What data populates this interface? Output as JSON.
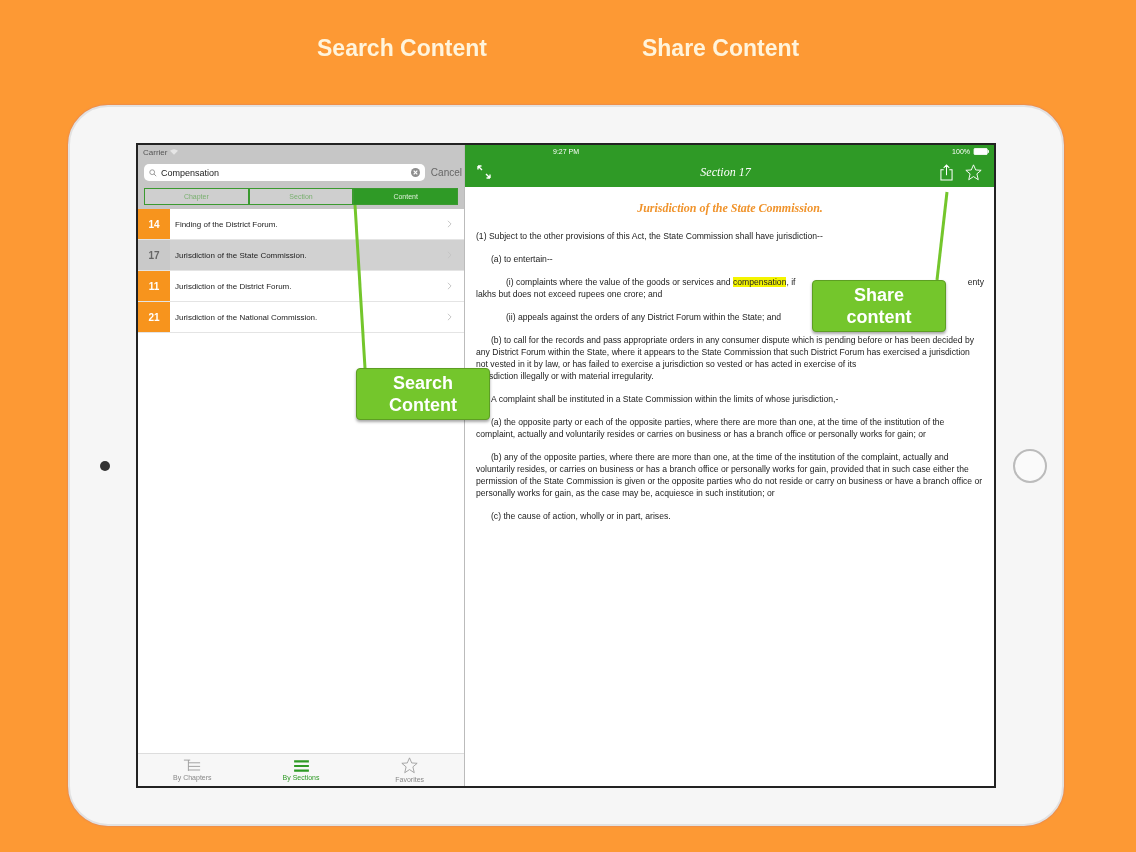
{
  "headlines": [
    {
      "text": "Search Content"
    },
    {
      "text": "Share Content"
    }
  ],
  "left_pane": {
    "status_bar": {
      "carrier": "Carrier"
    },
    "search": {
      "value": "Compensation",
      "cancel": "Cancel"
    },
    "scope_tabs": [
      {
        "label": "Chapter",
        "selected": false
      },
      {
        "label": "Section",
        "selected": false
      },
      {
        "label": "Content",
        "selected": true
      }
    ],
    "results": [
      {
        "number": "14",
        "title": "Finding of the District Forum.",
        "selected": false
      },
      {
        "number": "17",
        "title": "Jurisdiction of the State Commission.",
        "selected": true
      },
      {
        "number": "11",
        "title": "Jurisdiction of the District Forum.",
        "selected": false
      },
      {
        "number": "21",
        "title": "Jurisdiction of the National Commission.",
        "selected": false
      }
    ],
    "tab_bar": [
      {
        "label": "By Chapters",
        "kind": "chapters",
        "selected": false
      },
      {
        "label": "By Sections",
        "kind": "sections",
        "selected": true
      },
      {
        "label": "Favorites",
        "kind": "favorites",
        "selected": false
      }
    ]
  },
  "detail_pane": {
    "status_bar": {
      "time": "9:27 PM",
      "battery": "100%"
    },
    "title": "Section 17",
    "heading": "Jurisdiction of the State Commission.",
    "paragraphs": [
      {
        "kind": "plain",
        "text": "(1) Subject to the other provisions of this Act, the State Commission shall have jurisdiction--"
      },
      {
        "kind": "item",
        "text": "(a) to entertain--"
      },
      {
        "kind": "split",
        "parts": [
          {
            "text": "(i) complaints where the value of the goods or services and ",
            "highlighted": false
          },
          {
            "text": "compensation",
            "highlighted": true
          },
          {
            "text": ", if",
            "highlighted": false
          }
        ],
        "tail": "enty",
        "continuation": "lakhs but does not exceed rupees one crore; and"
      },
      {
        "kind": "subitem",
        "text": "(ii) appeals against the orders of any District Forum within the State; and"
      },
      {
        "kind": "covered",
        "text": "(b) to call for the records and pass appropriate orders in any consumer dispute which is pending before or has been decided by any District Forum within the State, where it appears to the State Commission that such District Forum has exercised a jurisdiction not vested in it by law, or has failed to exercise a jurisdiction so vested or has acted in exercise of its",
        "continuation": "sdiction illegally or with material irregularity."
      },
      {
        "kind": "item",
        "text": "A complaint shall be instituted in a State Commission within the limits of whose jurisdiction,-"
      },
      {
        "kind": "item",
        "text": "(a) the opposite party or each of the opposite parties, where there are more than one, at the time of the institution of the complaint, actually and voluntarily resides or carries on business or has a branch office or personally works for gain; or"
      },
      {
        "kind": "item",
        "text": "(b) any of the opposite parties, where there are more than one, at the time of the institution of the complaint, actually and voluntarily resides, or carries on business or has a branch office or personally works for gain, provided that in such case either the permission of the State Commission is given or the opposite parties who do not reside or carry on business or have a branch office or personally works for gain, as the case may be, acquiesce in such institution; or"
      },
      {
        "kind": "item",
        "text": "(c) the cause of action, wholly or in part, arises."
      }
    ]
  },
  "callouts": [
    {
      "kind": "search",
      "lines": [
        "Search",
        "Content"
      ]
    },
    {
      "kind": "share",
      "lines": [
        "Share",
        "content"
      ]
    }
  ]
}
